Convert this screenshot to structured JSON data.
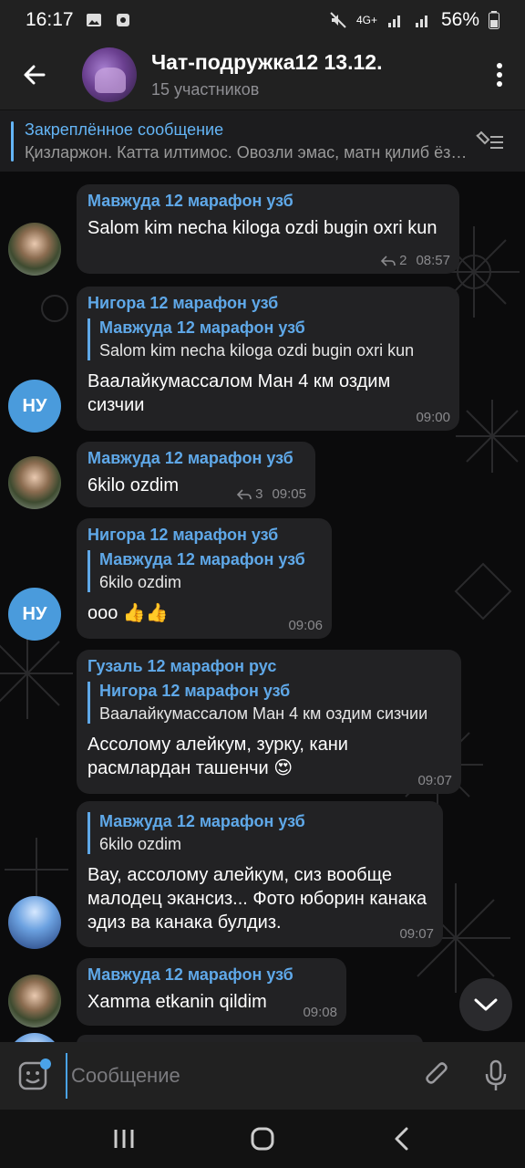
{
  "status": {
    "time": "16:17",
    "network": "4G+",
    "battery": "56%"
  },
  "header": {
    "title": "Чат-подружка12 13.12.",
    "subtitle": "15 участников"
  },
  "pinned": {
    "title": "Закреплённое сообщение",
    "text": "Қизларжон. Катта илтимос. Овозли эмас, матн қилиб ёзинглар"
  },
  "messages": [
    {
      "sender": "Мавжуда 12 марафон узб",
      "text": "Salom kim necha kiloga ozdi  bugin oxri kun",
      "replies": "2",
      "time": "08:57"
    },
    {
      "sender": "Нигора 12 марафон узб",
      "reply_name": "Мавжуда 12 марафон узб",
      "reply_text": "Salom kim necha kiloga ozdi  bugin oxri kun",
      "text": "Ваалайкумассалом Ман 4 км оздим сизчии",
      "avatar_initials": "НУ",
      "time": "09:00"
    },
    {
      "sender": "Мавжуда 12 марафон узб",
      "text": "6kilo  ozdim",
      "replies": "3",
      "time": "09:05"
    },
    {
      "sender": "Нигора 12 марафон узб",
      "reply_name": "Мавжуда 12 марафон узб",
      "reply_text": "6kilo  ozdim",
      "text": "ооо 👍👍",
      "avatar_initials": "НУ",
      "time": "09:06"
    },
    {
      "sender": "Гузаль 12 марафон рус",
      "reply_name": "Нигора 12 марафон узб",
      "reply_text": "Ваалайкумассалом Ман 4 км оздим сизчии",
      "text": "Ассолому алейкум, зурку, кани расмлардан ташенчи 😍",
      "time": "09:07"
    },
    {
      "reply_name": "Мавжуда 12 марафон узб",
      "reply_text": "6kilo  ozdim",
      "text": "Вау, ассолому алейкум, сиз вообще малодец экансиз... Фото юборин канака эдиз ва канака булдиз.",
      "time": "09:07"
    },
    {
      "sender": "Мавжуда 12 марафон узб",
      "text": "Xamma etkanin qildim",
      "time": "09:08"
    }
  ],
  "input": {
    "placeholder": "Сообщение"
  },
  "colors": {
    "accent": "#5fa8e8",
    "bubble": "#222224",
    "bar": "#212121"
  }
}
